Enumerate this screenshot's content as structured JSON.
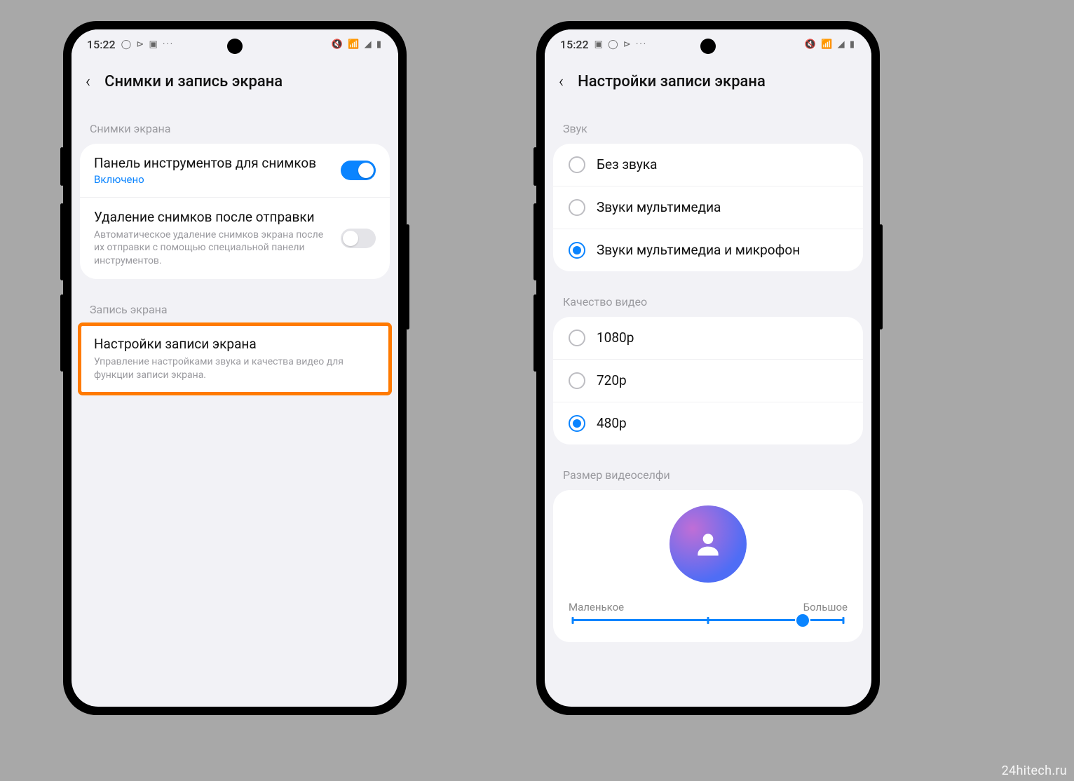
{
  "watermark": "24hitech.ru",
  "phone1": {
    "status": {
      "time": "15:22",
      "left_icons": "◯ ⊳ ▣  ···",
      "right_icons": "🔇 📶 ◢ ▮"
    },
    "title": "Снимки и запись экрана",
    "section_screenshots": "Снимки экрана",
    "toolbar": {
      "title": "Панель инструментов для снимков",
      "state": "Включено"
    },
    "delete_after_send": {
      "title": "Удаление снимков после отправки",
      "desc": "Автоматическое удаление снимков экрана после их отправки с помощью специальной панели инструментов."
    },
    "section_recording": "Запись экрана",
    "recording_settings": {
      "title": "Настройки записи экрана",
      "desc": "Управление настройками звука и качества видео для функции записи экрана."
    }
  },
  "phone2": {
    "status": {
      "time": "15:22",
      "left_icons": "▣ ◯ ⊳  ···",
      "right_icons": "🔇 📶 ◢ ▮"
    },
    "title": "Настройки записи экрана",
    "section_sound": "Звук",
    "sound_options": [
      "Без звука",
      "Звуки мультимедиа",
      "Звуки мультимедиа и микрофон"
    ],
    "sound_selected_index": 2,
    "section_quality": "Качество видео",
    "quality_options": [
      "1080p",
      "720p",
      "480p"
    ],
    "quality_selected_index": 2,
    "section_selfie": "Размер видеоселфи",
    "slider_min_label": "Маленькое",
    "slider_max_label": "Большое",
    "slider_value_percent": 85
  }
}
